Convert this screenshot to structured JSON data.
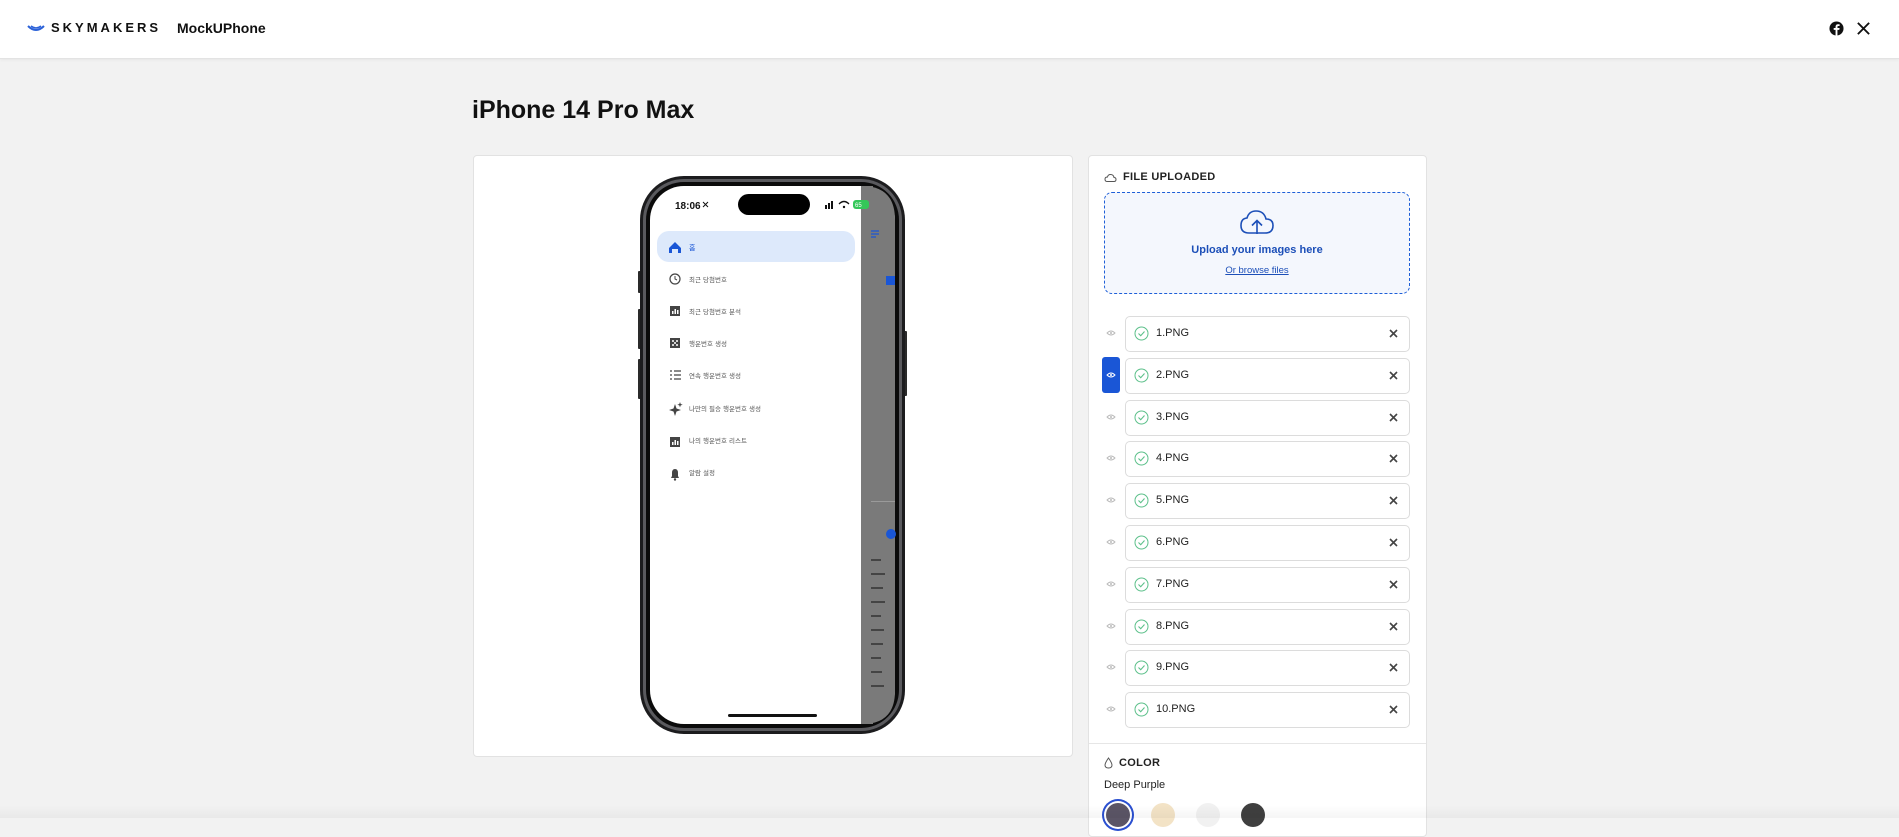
{
  "header": {
    "logo_text": "SKYMAKERS",
    "app_name": "MockUPhone",
    "social_icons": [
      "facebook-icon",
      "x-icon"
    ]
  },
  "page": {
    "title": "iPhone 14 Pro Max"
  },
  "phone_screen": {
    "status_time": "18:06",
    "battery_level": "65",
    "menu_items": [
      {
        "icon": "home-icon",
        "label": "홈"
      },
      {
        "icon": "history-icon",
        "label": "최근 당첨번호"
      },
      {
        "icon": "bar-chart-icon",
        "label": "최근 당첨번호 분석"
      },
      {
        "icon": "dice-icon",
        "label": "행운번호 생성"
      },
      {
        "icon": "list-icon",
        "label": "연속 행운번호 생성"
      },
      {
        "icon": "sparkle-icon",
        "label": "나만의 필승 행운번호 생성"
      },
      {
        "icon": "bar-chart-icon",
        "label": "나의 행운번호 리스트"
      },
      {
        "icon": "bell-icon",
        "label": "알람 설정"
      }
    ]
  },
  "upload_panel": {
    "section_title": "FILE UPLOADED",
    "dropzone_title": "Upload your images here",
    "dropzone_link": "Or browse files",
    "files": [
      {
        "name": "1.PNG",
        "active": false
      },
      {
        "name": "2.PNG",
        "active": true
      },
      {
        "name": "3.PNG",
        "active": false
      },
      {
        "name": "4.PNG",
        "active": false
      },
      {
        "name": "5.PNG",
        "active": false
      },
      {
        "name": "6.PNG",
        "active": false
      },
      {
        "name": "7.PNG",
        "active": false
      },
      {
        "name": "8.PNG",
        "active": false
      },
      {
        "name": "9.PNG",
        "active": false
      },
      {
        "name": "10.PNG",
        "active": false
      }
    ]
  },
  "color_section": {
    "title": "COLOR",
    "selected": "Deep Purple",
    "swatches": [
      {
        "color": "#5b5566",
        "selected": true
      },
      {
        "color": "#f3e3c6",
        "selected": false
      },
      {
        "color": "#f1f1f1",
        "selected": false
      },
      {
        "color": "#3f3f3f",
        "selected": false
      }
    ]
  },
  "colors": {
    "accent": "#1a56d6",
    "text_link": "#1c4fb8"
  }
}
